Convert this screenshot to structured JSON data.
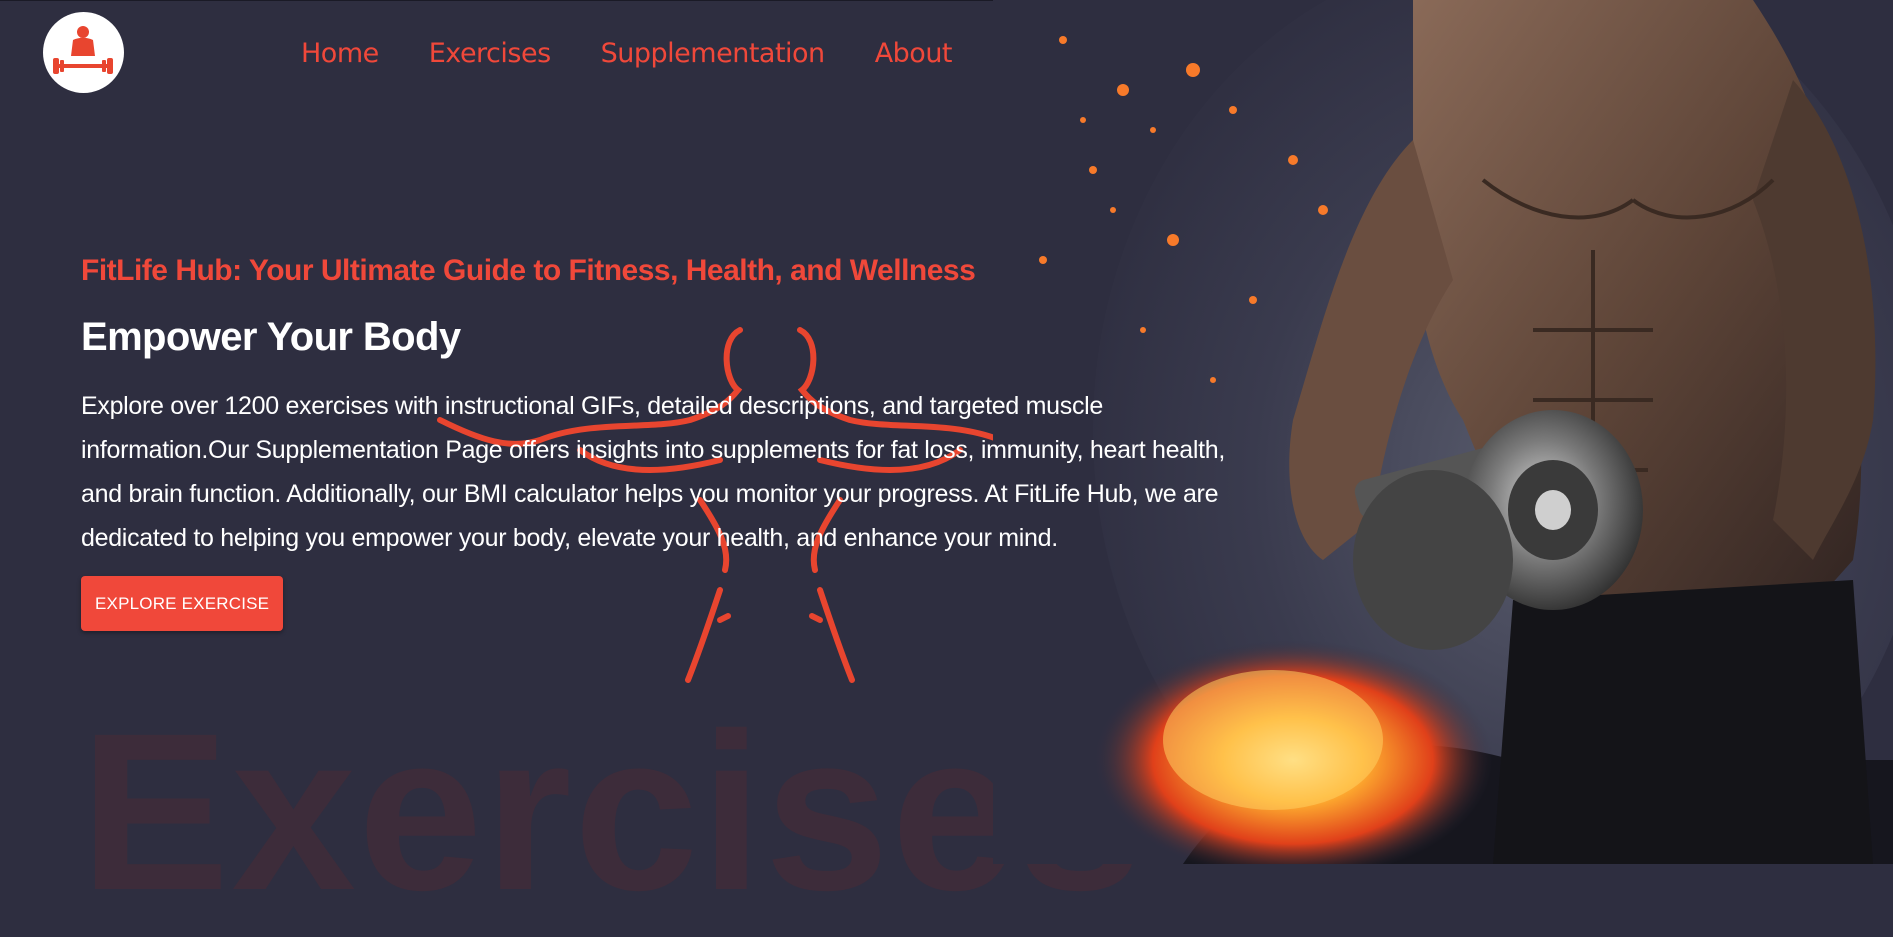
{
  "brand": {
    "logo_icon": "weightlifter-logo-icon",
    "accent": "#f0483a",
    "background": "#2e2e40"
  },
  "nav": {
    "items": [
      {
        "label": "Home"
      },
      {
        "label": "Exercises"
      },
      {
        "label": "Supplementation"
      },
      {
        "label": "About"
      }
    ]
  },
  "hero": {
    "tagline": "FitLife Hub: Your Ultimate Guide to Fitness, Health, and Wellness",
    "headline": "Empower Your Body",
    "description": "Explore over 1200 exercises with instructional GIFs, detailed descriptions, and targeted muscle information.Our Supplementation Page offers insights into supplements for fat loss, immunity, heart health, and brain function. Additionally, our BMI calculator helps you monitor your progress. At FitLife Hub, we are dedicated to helping you empower your body, elevate your health, and enhance your mind.",
    "cta_label": "EXPLORE EXERCISE",
    "image_icon": "bodybuilder-dumbbell-image"
  },
  "watermark": {
    "text": "Exercises"
  }
}
